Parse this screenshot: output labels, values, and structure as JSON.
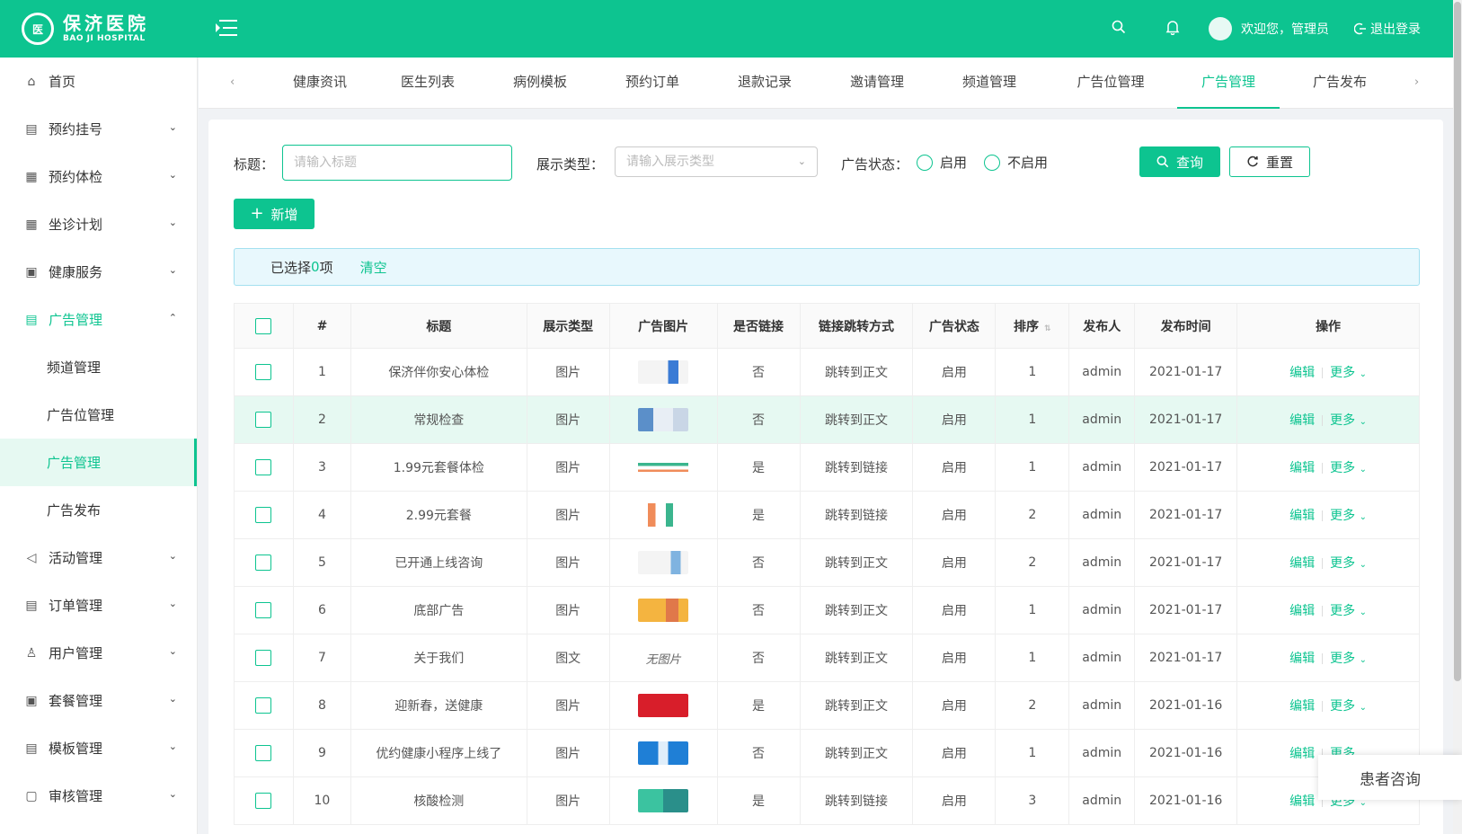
{
  "brand": {
    "name_cn": "保济医院",
    "name_en": "BAO JI HOSPITAL",
    "logo_mark": "医"
  },
  "header": {
    "welcome": "欢迎您，管理员",
    "logout": "退出登录"
  },
  "sidebar": {
    "items": [
      {
        "label": "首页",
        "icon": "home-icon"
      },
      {
        "label": "预约挂号",
        "icon": "register-icon"
      },
      {
        "label": "预约体检",
        "icon": "calendar-icon"
      },
      {
        "label": "坐诊计划",
        "icon": "schedule-icon"
      },
      {
        "label": "健康服务",
        "icon": "health-icon"
      },
      {
        "label": "广告管理",
        "icon": "ad-icon"
      },
      {
        "label": "活动管理",
        "icon": "megaphone-icon"
      },
      {
        "label": "订单管理",
        "icon": "order-icon"
      },
      {
        "label": "用户管理",
        "icon": "user-icon"
      },
      {
        "label": "套餐管理",
        "icon": "package-icon"
      },
      {
        "label": "模板管理",
        "icon": "template-icon"
      },
      {
        "label": "审核管理",
        "icon": "lock-icon"
      }
    ],
    "sub_items": [
      "频道管理",
      "广告位管理",
      "广告管理",
      "广告发布"
    ]
  },
  "tabs": [
    "健康资讯",
    "医生列表",
    "病例模板",
    "预约订单",
    "退款记录",
    "邀请管理",
    "频道管理",
    "广告位管理",
    "广告管理",
    "广告发布"
  ],
  "filter": {
    "title_label": "标题：",
    "title_placeholder": "请输入标题",
    "type_label": "展示类型：",
    "type_placeholder": "请输入展示类型",
    "status_label": "广告状态：",
    "status_on": "启用",
    "status_off": "不启用",
    "search": "查询",
    "reset": "重置"
  },
  "add_button": "新增",
  "selection": {
    "prefix": "已选择 ",
    "count": "0",
    "suffix": "项",
    "clear": "清空"
  },
  "table": {
    "columns": [
      "#",
      "标题",
      "展示类型",
      "广告图片",
      "是否链接",
      "链接跳转方式",
      "广告状态",
      "排序",
      "发布人",
      "发布时间",
      "操作"
    ],
    "rows": [
      {
        "no": "1",
        "title": "保济伴你安心体检",
        "type": "图片",
        "image": "img",
        "link": "否",
        "jump": "跳转到正文",
        "status": "启用",
        "order": "1",
        "author": "admin",
        "date": "2021-01-17"
      },
      {
        "no": "2",
        "title": "常规检查",
        "type": "图片",
        "image": "img",
        "link": "否",
        "jump": "跳转到正文",
        "status": "启用",
        "order": "1",
        "author": "admin",
        "date": "2021-01-17"
      },
      {
        "no": "3",
        "title": "1.99元套餐体检",
        "type": "图片",
        "image": "img",
        "link": "是",
        "jump": "跳转到链接",
        "status": "启用",
        "order": "1",
        "author": "admin",
        "date": "2021-01-17"
      },
      {
        "no": "4",
        "title": "2.99元套餐",
        "type": "图片",
        "image": "img",
        "link": "是",
        "jump": "跳转到链接",
        "status": "启用",
        "order": "2",
        "author": "admin",
        "date": "2021-01-17"
      },
      {
        "no": "5",
        "title": "已开通上线咨询",
        "type": "图片",
        "image": "img",
        "link": "否",
        "jump": "跳转到正文",
        "status": "启用",
        "order": "2",
        "author": "admin",
        "date": "2021-01-17"
      },
      {
        "no": "6",
        "title": "底部广告",
        "type": "图片",
        "image": "img",
        "link": "否",
        "jump": "跳转到正文",
        "status": "启用",
        "order": "1",
        "author": "admin",
        "date": "2021-01-17"
      },
      {
        "no": "7",
        "title": "关于我们",
        "type": "图文",
        "image": "无图片",
        "link": "否",
        "jump": "跳转到正文",
        "status": "启用",
        "order": "1",
        "author": "admin",
        "date": "2021-01-17"
      },
      {
        "no": "8",
        "title": "迎新春，送健康",
        "type": "图片",
        "image": "img",
        "link": "是",
        "jump": "跳转到正文",
        "status": "启用",
        "order": "2",
        "author": "admin",
        "date": "2021-01-16"
      },
      {
        "no": "9",
        "title": "优约健康小程序上线了",
        "type": "图片",
        "image": "img",
        "link": "否",
        "jump": "跳转到正文",
        "status": "启用",
        "order": "1",
        "author": "admin",
        "date": "2021-01-16"
      },
      {
        "no": "10",
        "title": "核酸检测",
        "type": "图片",
        "image": "img",
        "link": "是",
        "jump": "跳转到链接",
        "status": "启用",
        "order": "3",
        "author": "admin",
        "date": "2021-01-16"
      }
    ],
    "op_edit": "编辑",
    "op_more": "更多"
  },
  "consult": "患者咨询",
  "colors": {
    "primary": "#0dc490",
    "highlight_row": "#e6f9f2",
    "alert_bg": "#e8f8fd"
  }
}
